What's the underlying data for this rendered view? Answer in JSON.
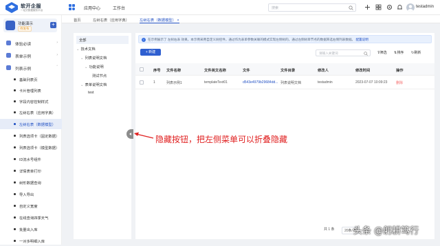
{
  "app": {
    "brand": "软开企服",
    "brand_sub": "一站式数据服务平台",
    "topnav": [
      "应用中心",
      "工作台"
    ],
    "search_placeholder": "搜索",
    "username": "testadmin"
  },
  "project": {
    "name": "功能演示",
    "badge": "待发布"
  },
  "sidebar": {
    "groups": [
      {
        "label": "体验必读"
      },
      {
        "label": "表单示例"
      },
      {
        "label": "列表示例"
      }
    ],
    "items": [
      {
        "label": "基础列表页"
      },
      {
        "label": "卡片管理列表"
      },
      {
        "label": "字段内容控制样式"
      },
      {
        "label": "左树右表（应用字典）"
      },
      {
        "label": "左树右表（数据模型）"
      },
      {
        "label": "列表选项卡（固定数据）"
      },
      {
        "label": "列表选项卡（模型数据）"
      },
      {
        "label": "ID流水号组件"
      },
      {
        "label": "详情表单打印"
      },
      {
        "label": "树形数据查询"
      },
      {
        "label": "导入导出"
      },
      {
        "label": "自定义宽度"
      },
      {
        "label": "在线查询四季天气"
      },
      {
        "label": "批量出入库"
      },
      {
        "label": "一对多明细入库"
      }
    ]
  },
  "tabs": [
    "首页",
    "左树右表（应用字典）",
    "左树右表（数据模型）"
  ],
  "tree": {
    "all": "全部",
    "nodes": [
      "技术文档",
      "列表说明文档",
      "功能说明",
      "测试节点",
      "表单说明文档",
      "test"
    ]
  },
  "notice": {
    "text": "在示例展示了 左树右表 效果。本示例采用自定义树控件，通过作为表单参数关联的模式实现左侧树的，通过左侧树单节点的数据筛选右侧列表数据。",
    "link": "配置说明"
  },
  "toolbar": {
    "new_label": "新建",
    "search_placeholder": "请输入关键词",
    "filter": "筛选",
    "sort": "排序",
    "refresh": "刷新"
  },
  "table": {
    "headers": [
      "序号",
      "文件名称",
      "文件英文名称",
      "文件",
      "文件目录",
      "修改人",
      "修改时间",
      "操作"
    ],
    "rows": [
      {
        "no": "1",
        "name": "列表示例1",
        "en": "templateText01",
        "file": "d543e4979b29684dd...",
        "dir": "列表说明文档",
        "editor": "testadmin",
        "time": "2023-07-07 10:09:23",
        "action": "删除"
      }
    ]
  },
  "pager": {
    "total": "共 1 条",
    "size": "20条/页"
  },
  "annotation": "隐藏按钮，把左侧菜单可以折叠隐藏",
  "watermark": "头条 @躬耕笃行"
}
